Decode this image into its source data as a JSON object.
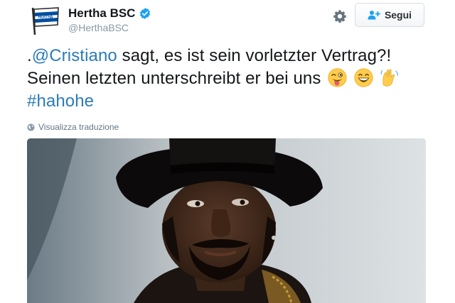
{
  "profile": {
    "display_name": "Hertha BSC",
    "handle": "@HerthaBSC",
    "verified": true,
    "avatar_icon": "hertha-flag-crest-icon"
  },
  "actions": {
    "settings_icon": "gear-icon",
    "follow_label": "Segui",
    "follow_icon": "add-user-icon"
  },
  "tweet": {
    "prefix": ".",
    "mention": "@Cristiano",
    "line1_rest": " sagt, es ist sein vorletzter Vertrag?!",
    "line2": "Seinen letzten unterschreibt er bei uns",
    "emojis": [
      "winking-face-tongue-icon",
      "grinning-face-icon",
      "waving-hands-icon"
    ],
    "hashtag": "#hahohe"
  },
  "translate_label": "Visualizza traduzione",
  "media": {
    "type": "gif-image",
    "subject": "man-in-top-hat"
  },
  "colors": {
    "link": "#2b7bb9",
    "verified": "#1da1f2",
    "muted": "#8899a6",
    "brand_blue": "#004d9e"
  }
}
